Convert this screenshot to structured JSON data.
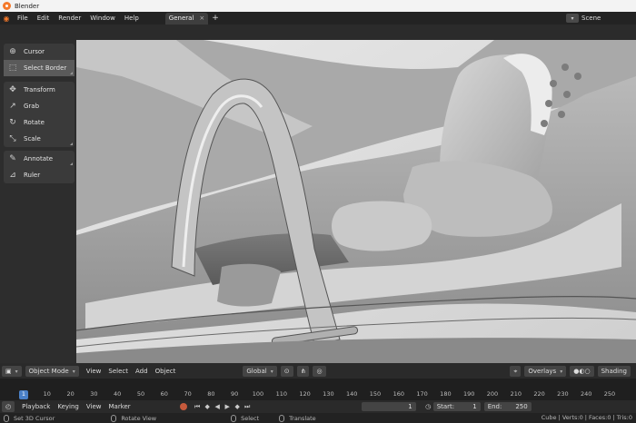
{
  "window": {
    "title": "Blender"
  },
  "menubar": {
    "items": [
      "File",
      "Edit",
      "Render",
      "Window",
      "Help"
    ],
    "workspace_tab": "General",
    "close_symbol": "×",
    "add_symbol": "+",
    "scene": "Scene"
  },
  "toolbar": {
    "tools": [
      {
        "label": "Cursor",
        "icon": "cursor-icon",
        "glyph": "⊕"
      },
      {
        "label": "Select Border",
        "icon": "select-box-icon",
        "glyph": "⬚"
      },
      {
        "label": "Transform",
        "icon": "transform-icon",
        "glyph": "✥"
      },
      {
        "label": "Grab",
        "icon": "grab-icon",
        "glyph": "↗"
      },
      {
        "label": "Rotate",
        "icon": "rotate-icon",
        "glyph": "↻"
      },
      {
        "label": "Scale",
        "icon": "scale-icon",
        "glyph": "⤡"
      },
      {
        "label": "Annotate",
        "icon": "annotate-icon",
        "glyph": "✎"
      },
      {
        "label": "Ruler",
        "icon": "ruler-icon",
        "glyph": "⊿"
      }
    ]
  },
  "viewport_header": {
    "mode": "Object Mode",
    "menus": [
      "View",
      "Select",
      "Add",
      "Object"
    ],
    "orientation": "Global",
    "overlays": "Overlays",
    "shading": "Shading"
  },
  "timeline": {
    "current_frame_label": "1",
    "ticks": [
      "10",
      "20",
      "30",
      "40",
      "50",
      "60",
      "70",
      "80",
      "90",
      "100",
      "110",
      "120",
      "130",
      "140",
      "150",
      "160",
      "170",
      "180",
      "190",
      "200",
      "210",
      "220",
      "230",
      "240",
      "250"
    ]
  },
  "playback": {
    "menus": [
      "Playback",
      "Keying",
      "View",
      "Marker"
    ],
    "current_frame": "1",
    "start_label": "Start:",
    "start": "1",
    "end_label": "End:",
    "end": "250"
  },
  "statusbar": {
    "hints": [
      "Set 3D Cursor",
      "Rotate View",
      "Select",
      "Translate"
    ],
    "stats": "Cube | Verts:0 | Faces:0 | Tris:0"
  },
  "colors": {
    "accent_orange": "#f5792a",
    "frame_blue": "#4a80c7",
    "record_red": "#c65a3c"
  }
}
